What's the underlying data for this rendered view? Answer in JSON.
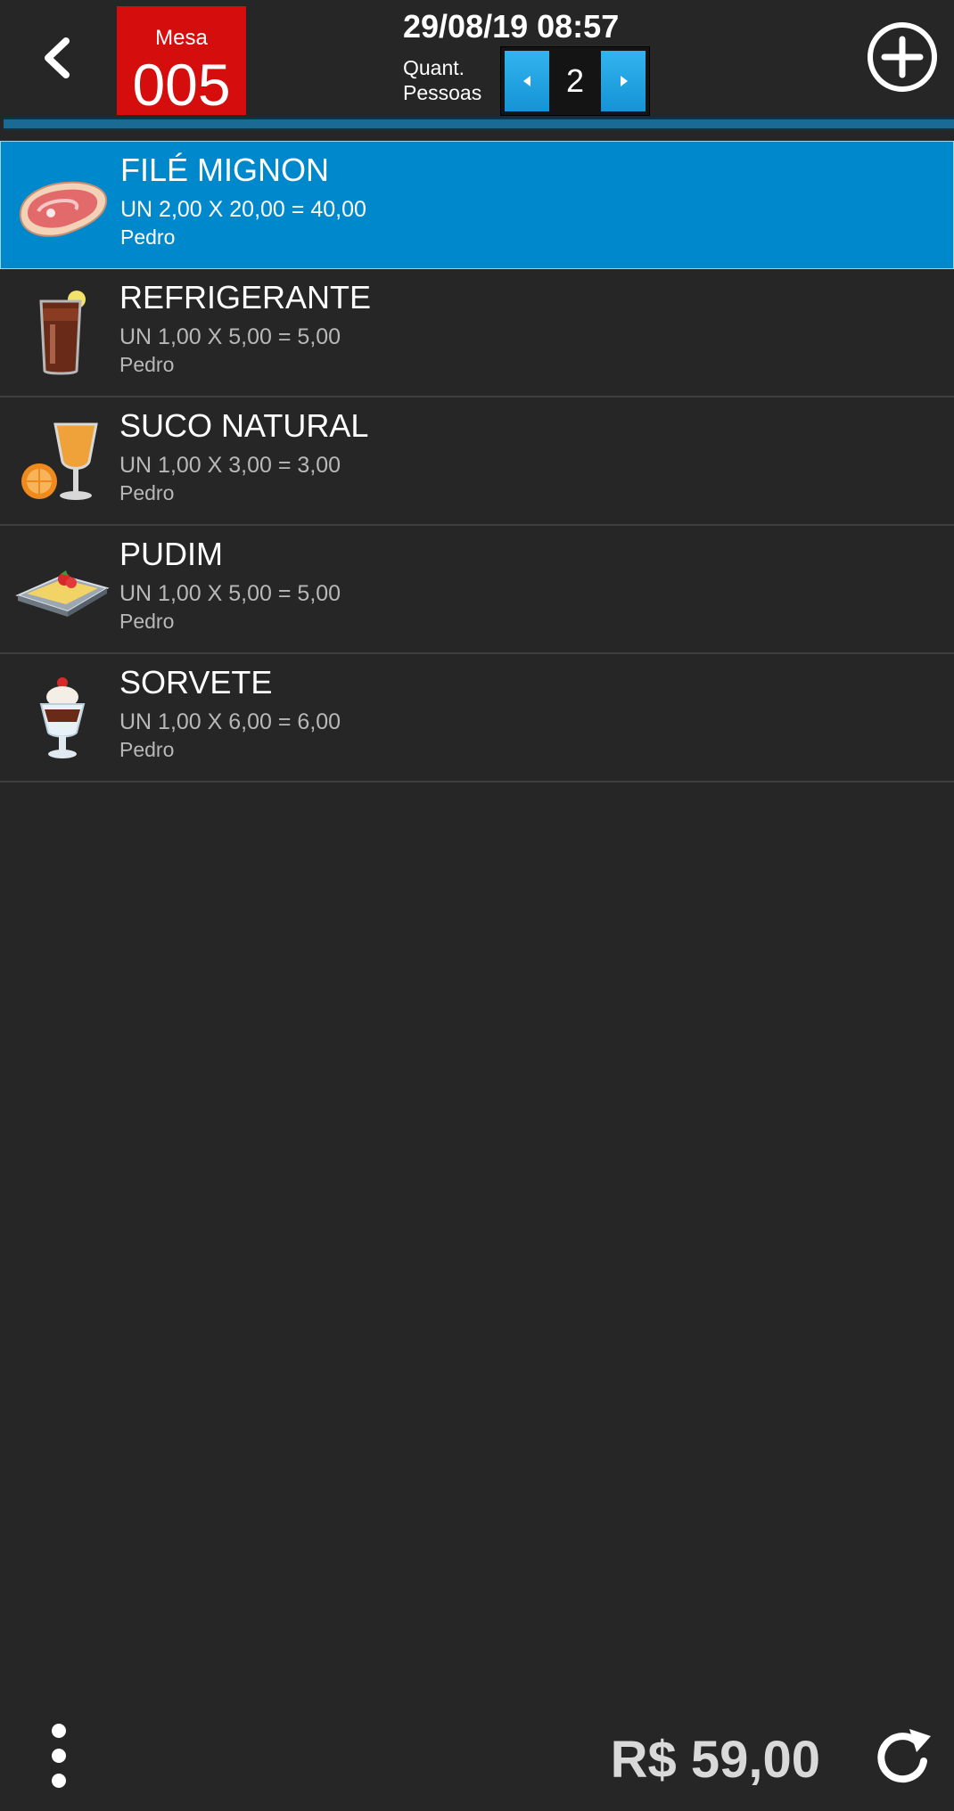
{
  "header": {
    "table_label": "Mesa",
    "table_number": "005",
    "datetime": "29/08/19 08:57",
    "people_label_line1": "Quant.",
    "people_label_line2": "Pessoas",
    "people_count": "2"
  },
  "items": [
    {
      "name": "FILÉ MIGNON",
      "detail": "UN 2,00 X 20,00 = 40,00",
      "person": "Pedro",
      "icon": "steak-icon",
      "selected": true
    },
    {
      "name": "REFRIGERANTE",
      "detail": "UN 1,00 X 5,00 = 5,00",
      "person": "Pedro",
      "icon": "soda-glass-icon",
      "selected": false
    },
    {
      "name": "SUCO NATURAL",
      "detail": "UN 1,00 X 3,00 = 3,00",
      "person": "Pedro",
      "icon": "juice-glass-icon",
      "selected": false
    },
    {
      "name": "PUDIM",
      "detail": "UN 1,00 X 5,00 = 5,00",
      "person": "Pedro",
      "icon": "pudding-icon",
      "selected": false
    },
    {
      "name": "SORVETE",
      "detail": "UN 1,00 X 6,00 = 6,00",
      "person": "Pedro",
      "icon": "sundae-icon",
      "selected": false
    }
  ],
  "footer": {
    "total": "R$ 59,00"
  },
  "colors": {
    "background": "#262626",
    "table_badge": "#d50d0d",
    "selected_row": "#0088cc",
    "stepper_button": "#1593d6"
  }
}
